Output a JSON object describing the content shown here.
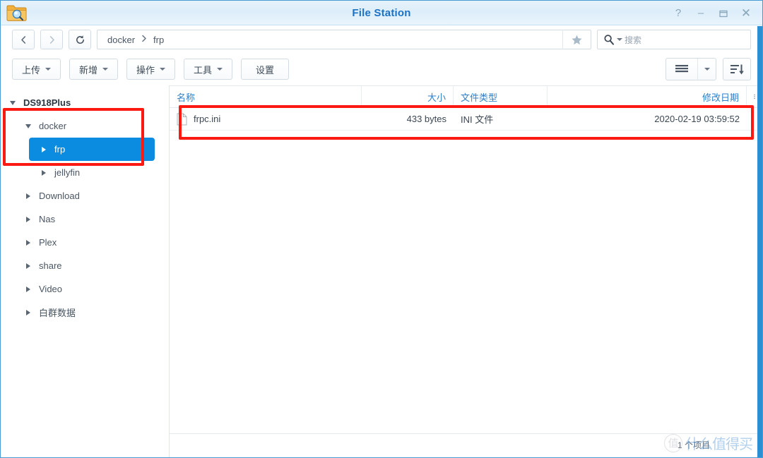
{
  "window": {
    "title": "File Station",
    "icon": "folder-search-icon",
    "controls": [
      {
        "name": "help",
        "glyph": "?"
      },
      {
        "name": "minimize",
        "glyph": "–"
      },
      {
        "name": "maximize",
        "glyph": "❐"
      },
      {
        "name": "close",
        "glyph": "✕"
      }
    ],
    "accent_color": "#1b72c4",
    "edge_color": "#2b8fd4"
  },
  "navbar": {
    "back": "‹",
    "forward": "›",
    "refresh": "↻",
    "breadcrumbs": [
      "docker",
      "frp"
    ],
    "separator": "›",
    "favorite_icon": "star-icon",
    "search": {
      "placeholder": "搜索",
      "icon": "search-icon"
    }
  },
  "toolbar": {
    "buttons": [
      {
        "label": "上传",
        "has_caret": true,
        "name": "upload"
      },
      {
        "label": "新增",
        "has_caret": true,
        "name": "create"
      },
      {
        "label": "操作",
        "has_caret": true,
        "name": "action"
      },
      {
        "label": "工具",
        "has_caret": true,
        "name": "tools"
      },
      {
        "label": "设置",
        "has_caret": false,
        "name": "settings"
      }
    ],
    "view_button": "list-view-icon",
    "view_caret": "chevron-down-icon",
    "sort_button": "sort-descending-icon"
  },
  "sidebar": {
    "items": [
      {
        "label": "DS918Plus",
        "depth": 0,
        "expanded": true,
        "selected": false
      },
      {
        "label": "docker",
        "depth": 1,
        "expanded": true,
        "selected": false
      },
      {
        "label": "frp",
        "depth": 2,
        "expanded": false,
        "selected": true
      },
      {
        "label": "jellyfin",
        "depth": 2,
        "expanded": false,
        "selected": false
      },
      {
        "label": "Download",
        "depth": 1,
        "expanded": false,
        "selected": false
      },
      {
        "label": "Nas",
        "depth": 1,
        "expanded": false,
        "selected": false
      },
      {
        "label": "Plex",
        "depth": 1,
        "expanded": false,
        "selected": false
      },
      {
        "label": "share",
        "depth": 1,
        "expanded": false,
        "selected": false
      },
      {
        "label": "Video",
        "depth": 1,
        "expanded": false,
        "selected": false
      },
      {
        "label": "白群数据",
        "depth": 1,
        "expanded": false,
        "selected": false
      }
    ],
    "selected_color": "#0c8ce0"
  },
  "filelist": {
    "columns": [
      {
        "key": "name",
        "label": "名称"
      },
      {
        "key": "size",
        "label": "大小"
      },
      {
        "key": "type",
        "label": "文件类型"
      },
      {
        "key": "date",
        "label": "修改日期"
      }
    ],
    "column_menu_icon": "more-options-icon",
    "rows": [
      {
        "name": "frpc.ini",
        "size": "433 bytes",
        "type": "INI 文件",
        "date": "2020-02-19 03:59:52",
        "icon": "file-icon"
      }
    ]
  },
  "statusbar": {
    "text": "1 个项目"
  },
  "watermark": {
    "mark": "值",
    "text": "什么值得买"
  },
  "annotations": {
    "color": "#fb1a12",
    "boxes": [
      {
        "name": "sidebar-highlight",
        "target": "docker-frp-tree-nodes"
      },
      {
        "name": "file-row-highlight",
        "target": "frpc-ini-row"
      }
    ]
  }
}
